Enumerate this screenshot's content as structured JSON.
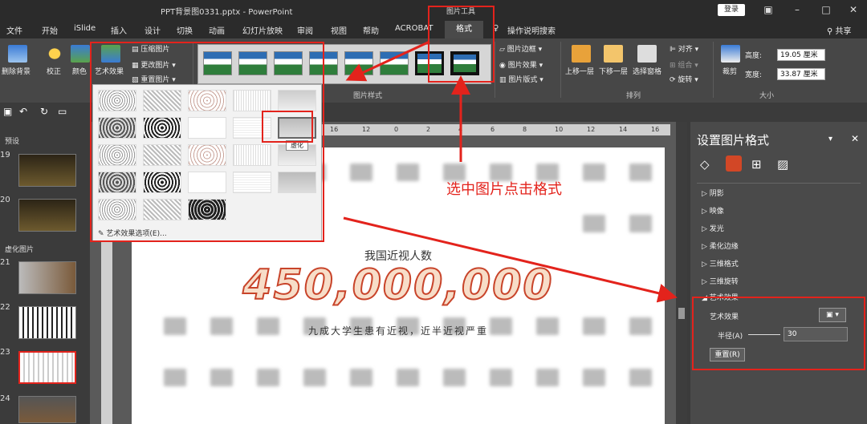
{
  "titlebar": {
    "doc_title": "PPT背景图0331.pptx - PowerPoint",
    "context_tab": "图片工具",
    "login": "登录"
  },
  "tabs": [
    "文件",
    "开始",
    "iSlide",
    "插入",
    "设计",
    "切换",
    "动画",
    "幻灯片放映",
    "审阅",
    "视图",
    "帮助",
    "ACROBAT"
  ],
  "active_tab": "格式",
  "tell_me": "操作说明搜索",
  "share": "共享",
  "ribbon": {
    "remove_bg": "删除背景",
    "correct": "校正",
    "color": "颜色",
    "artistic": "艺术效果",
    "compress": "压缩图片",
    "change": "更改图片",
    "reset": "重置图片",
    "group_styles": "图片样式",
    "border": "图片边框",
    "effects": "图片效果",
    "layout": "图片版式",
    "bring_forward": "上移一层",
    "send_backward": "下移一层",
    "selection_pane": "选择窗格",
    "align": "对齐",
    "group": "组合",
    "rotate": "旋转",
    "group_arrange": "排列",
    "crop": "裁剪",
    "height_label": "高度:",
    "height_value": "19.05 厘米",
    "width_label": "宽度:",
    "width_value": "33.87 厘米",
    "group_size": "大小"
  },
  "gallery": {
    "option": "艺术效果选项(E)...",
    "tooltip": "虚化"
  },
  "slides": {
    "section1": "预设",
    "section2": "虚化图片",
    "numbers": [
      "19",
      "20",
      "21",
      "22",
      "23",
      "24"
    ]
  },
  "slide": {
    "headline": "我国近视人数",
    "big_number": "450,000,000",
    "subline": "九成大学生患有近视，近半近视严重"
  },
  "ruler": [
    "16",
    "14",
    "12",
    "10",
    "8",
    "6",
    "4",
    "2",
    "0",
    "2",
    "4",
    "6",
    "8",
    "10",
    "12",
    "14",
    "16"
  ],
  "panel": {
    "title": "设置图片格式",
    "sections": [
      "阴影",
      "映像",
      "发光",
      "柔化边缘",
      "三维格式",
      "三维旋转",
      "艺术效果"
    ],
    "artistic_label": "艺术效果",
    "radius_label": "半径(A)",
    "radius_value": "30",
    "reset_label": "重置(R)"
  },
  "annotation": {
    "text": "选中图片点击格式"
  },
  "colors": {
    "accent_red": "#e3231c",
    "ribbon_bg": "#474747",
    "dark_bg": "#2b2b2b"
  }
}
